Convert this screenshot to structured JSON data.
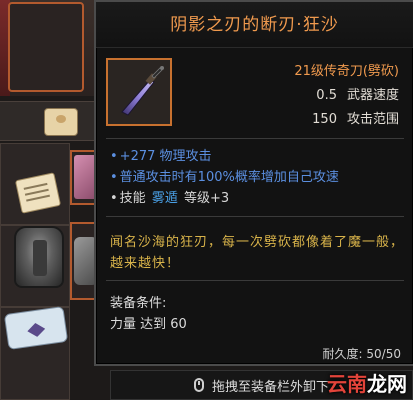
{
  "tooltip": {
    "title": "阴影之刃的断刃·狂沙",
    "item_type": "21级传奇刀(劈砍)",
    "stats": [
      {
        "value": "0.5",
        "label": "武器速度"
      },
      {
        "value": "150",
        "label": "攻击范围"
      }
    ],
    "affixes": [
      "+277 物理攻击",
      "普通攻击时有100%概率增加自己攻速"
    ],
    "skill_affix": {
      "prefix": "技能",
      "skill": "雾遁",
      "suffix": "等级+3"
    },
    "flavor_text": "闻名沙海的狂刃，每一次劈砍都像着了魔一般，越来越快！",
    "requirements_label": "装备条件:",
    "requirement": "力量 达到 60",
    "durability": "耐久度: 50/50",
    "bullet": "•",
    "icon": "sword-icon"
  },
  "action_bar": {
    "label": "拖拽至装备栏外卸下",
    "icon": "mouse-icon"
  },
  "watermark": {
    "red": "云南",
    "white": "龙网"
  },
  "colors": {
    "title": "#f09a4e",
    "affix_blue": "#5b8fe0",
    "skill_blue": "#4aa0e6",
    "flavor_gold": "#d8b34a",
    "border_orange": "#c8712f"
  }
}
